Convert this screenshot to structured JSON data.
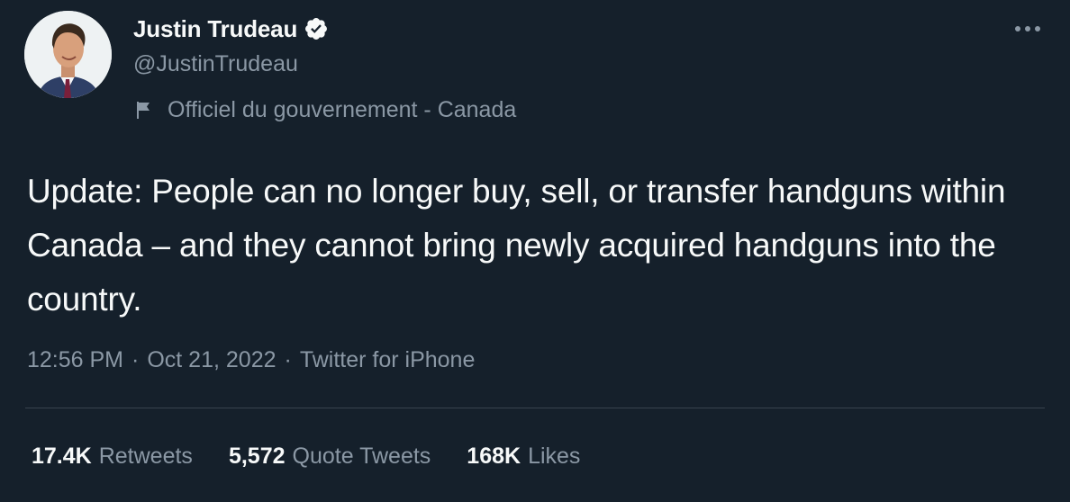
{
  "author": {
    "display_name": "Justin Trudeau",
    "handle": "@JustinTrudeau",
    "verified": true,
    "affiliation": "Officiel du gouvernement - Canada"
  },
  "tweet": {
    "text": "Update: People can no longer buy, sell, or transfer handguns within Canada – and they cannot bring newly acquired handguns into the country.",
    "time": "12:56 PM",
    "date": "Oct 21, 2022",
    "source": "Twitter for iPhone",
    "separator": "·"
  },
  "stats": {
    "retweets": {
      "count": "17.4K",
      "label": "Retweets"
    },
    "quotes": {
      "count": "5,572",
      "label": "Quote Tweets"
    },
    "likes": {
      "count": "168K",
      "label": "Likes"
    }
  },
  "icons": {
    "verified": "verified-badge-icon",
    "affiliation": "flag-icon",
    "more": "more-options-icon"
  },
  "colors": {
    "background": "#15202b",
    "primary_text": "#f7f9f9",
    "secondary_text": "#8b98a5",
    "divider": "#38444d"
  }
}
